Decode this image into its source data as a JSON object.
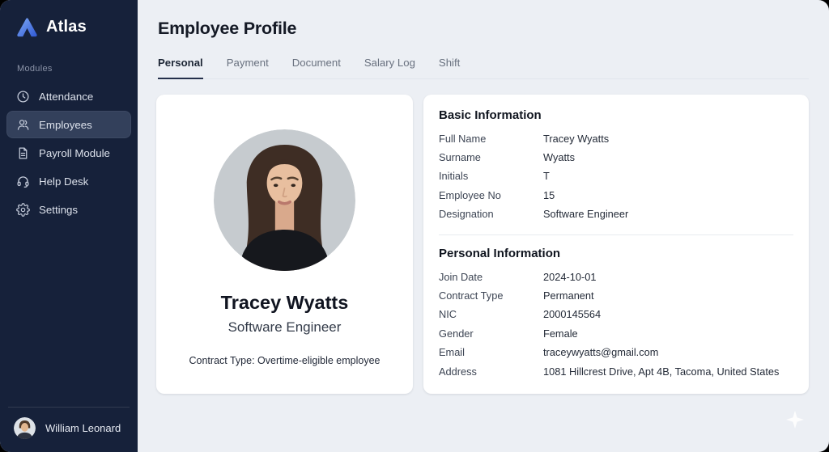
{
  "app": {
    "name": "Atlas"
  },
  "sidebar": {
    "section_label": "Modules",
    "items": [
      {
        "label": "Attendance",
        "icon": "clock-icon",
        "active": false
      },
      {
        "label": "Employees",
        "icon": "person-icon",
        "active": true
      },
      {
        "label": "Payroll Module",
        "icon": "document-icon",
        "active": false
      },
      {
        "label": "Help Desk",
        "icon": "headset-icon",
        "active": false
      },
      {
        "label": "Settings",
        "icon": "gear-icon",
        "active": false
      }
    ],
    "user": {
      "name": "William Leonard"
    }
  },
  "header": {
    "title": "Employee Profile"
  },
  "tabs": [
    {
      "label": "Personal",
      "active": true
    },
    {
      "label": "Payment",
      "active": false
    },
    {
      "label": "Document",
      "active": false
    },
    {
      "label": "Salary Log",
      "active": false
    },
    {
      "label": "Shift",
      "active": false
    }
  ],
  "profile_card": {
    "name": "Tracey Wyatts",
    "designation": "Software Engineer",
    "contract_note": "Contract Type: Overtime-eligible employee"
  },
  "basic_information": {
    "title": "Basic Information",
    "rows": [
      {
        "label": "Full Name",
        "value": "Tracey Wyatts"
      },
      {
        "label": "Surname",
        "value": "Wyatts"
      },
      {
        "label": "Initials",
        "value": "T"
      },
      {
        "label": "Employee No",
        "value": "15"
      },
      {
        "label": "Designation",
        "value": "Software Engineer"
      }
    ]
  },
  "personal_information": {
    "title": "Personal Information",
    "rows": [
      {
        "label": "Join Date",
        "value": "2024-10-01"
      },
      {
        "label": "Contract Type",
        "value": "Permanent"
      },
      {
        "label": "NIC",
        "value": "2000145564"
      },
      {
        "label": "Gender",
        "value": "Female"
      },
      {
        "label": "Email",
        "value": "traceywyatts@gmail.com"
      },
      {
        "label": "Address",
        "value": "1081 Hillcrest Drive, Apt 4B, Tacoma, United States"
      }
    ]
  },
  "colors": {
    "sidebar_bg": "#16213A",
    "sidebar_active_bg": "#33405B",
    "main_bg": "#ECEFF4",
    "card_bg": "#FFFFFF",
    "tab_underline": "#25304B",
    "logo_blue_light": "#7FAAF5",
    "logo_blue_dark": "#2F58D3"
  }
}
